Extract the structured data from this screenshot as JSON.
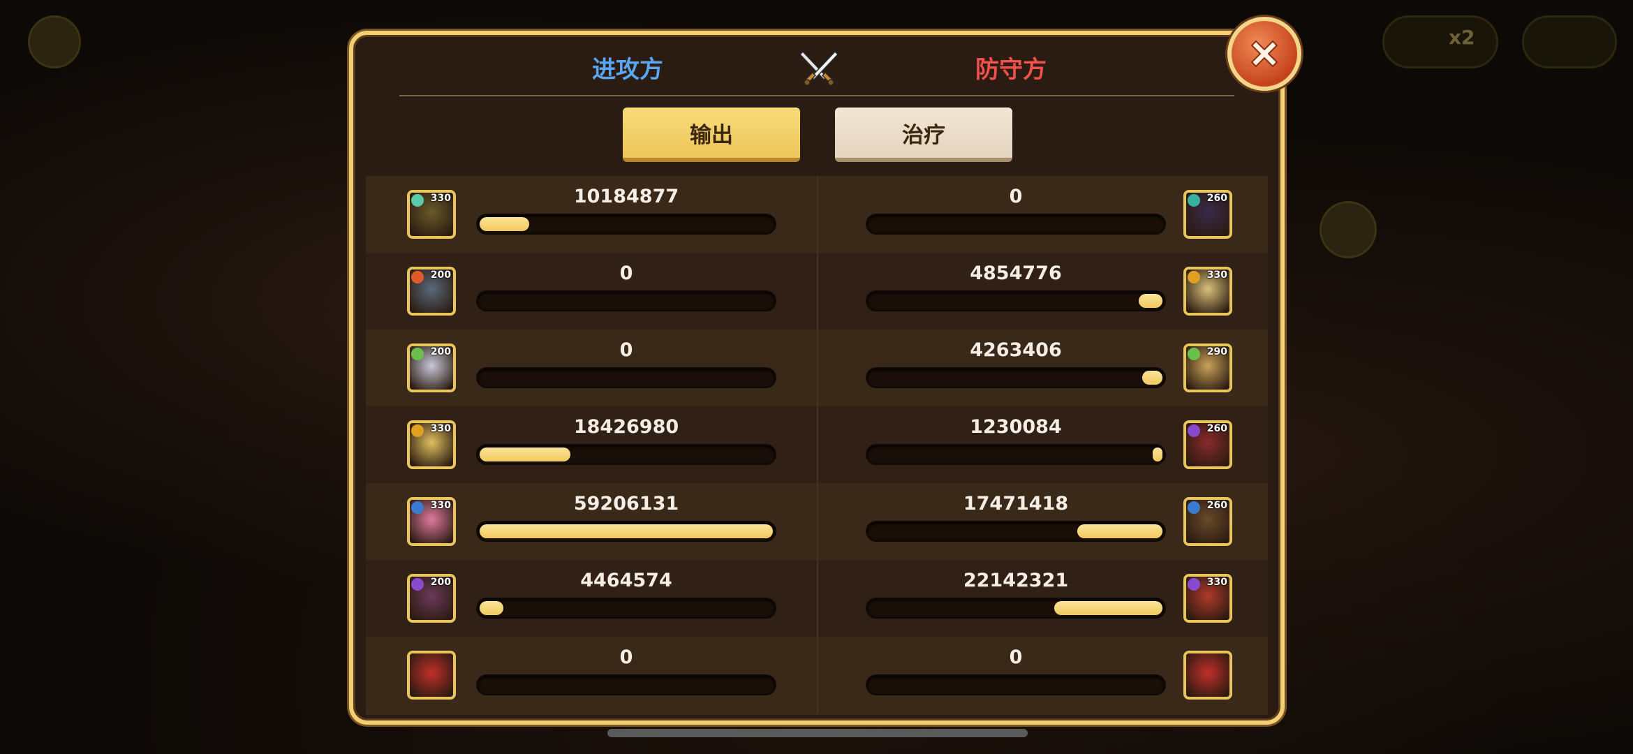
{
  "header": {
    "attacker_label": "进攻方",
    "defender_label": "防守方",
    "center_icon": "crossed-swords-icon",
    "close_icon": "close-icon"
  },
  "tabs": [
    {
      "label": "输出",
      "selected": true
    },
    {
      "label": "治疗",
      "selected": false
    }
  ],
  "colors": {
    "attacker": "#5aa6f2",
    "defender": "#f2504a",
    "bar_fill": "#f1c95e",
    "frame_gold": "#f2cf72"
  },
  "rows": [
    {
      "left": {
        "value": "10184877",
        "level": "330",
        "fill": 0.17
      },
      "right": {
        "value": "0",
        "level": "260",
        "fill": 0
      }
    },
    {
      "left": {
        "value": "0",
        "level": "200",
        "fill": 0
      },
      "right": {
        "value": "4854776",
        "level": "330",
        "fill": 0.08
      }
    },
    {
      "left": {
        "value": "0",
        "level": "200",
        "fill": 0
      },
      "right": {
        "value": "4263406",
        "level": "290",
        "fill": 0.07
      }
    },
    {
      "left": {
        "value": "18426980",
        "level": "330",
        "fill": 0.31
      },
      "right": {
        "value": "1230084",
        "level": "260",
        "fill": 0.02
      }
    },
    {
      "left": {
        "value": "59206131",
        "level": "330",
        "fill": 1.0
      },
      "right": {
        "value": "17471418",
        "level": "260",
        "fill": 0.29
      }
    },
    {
      "left": {
        "value": "4464574",
        "level": "200",
        "fill": 0.08
      },
      "right": {
        "value": "22142321",
        "level": "330",
        "fill": 0.37
      }
    },
    {
      "left": {
        "value": "0",
        "level": "",
        "fill": 0
      },
      "right": {
        "value": "0",
        "level": "",
        "fill": 0
      }
    }
  ],
  "background": {
    "speed_label": "x2"
  }
}
